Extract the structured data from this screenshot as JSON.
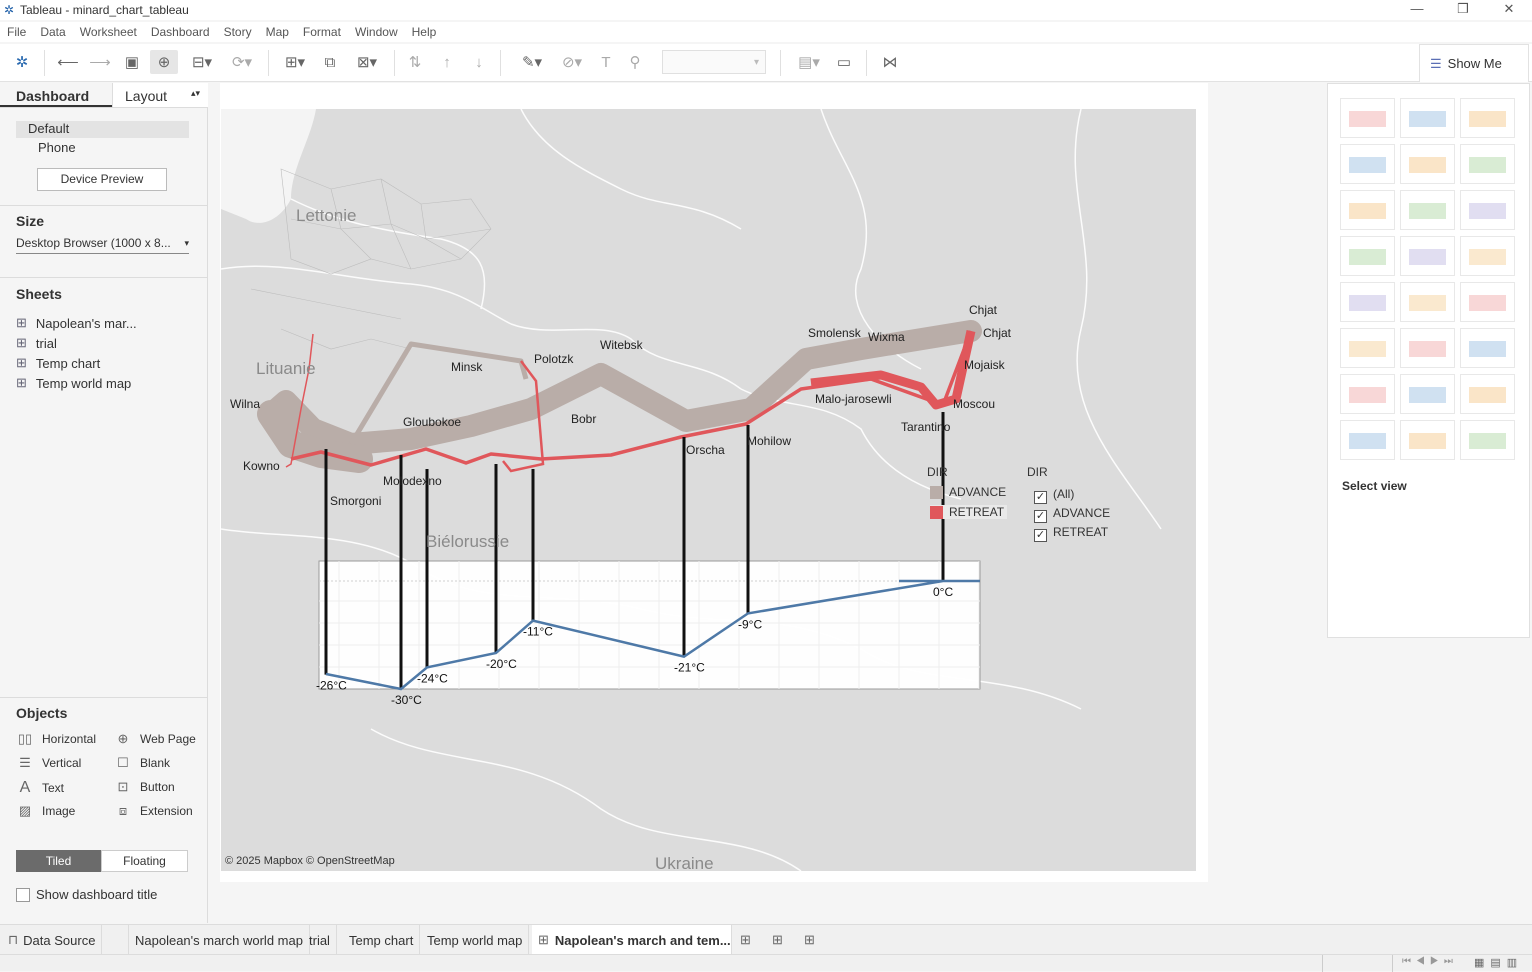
{
  "window": {
    "title": "Tableau - minard_chart_tableau",
    "controls": [
      "—",
      "❒",
      "✕"
    ]
  },
  "menu": [
    "File",
    "Data",
    "Worksheet",
    "Dashboard",
    "Story",
    "Map",
    "Format",
    "Window",
    "Help"
  ],
  "show_me": {
    "label": "Show Me",
    "select_view": "Select view"
  },
  "left": {
    "tab_dashboard": "Dashboard",
    "tab_layout": "Layout",
    "devices": [
      "Default",
      "Phone"
    ],
    "device_preview": "Device Preview",
    "size_title": "Size",
    "size_value": "Desktop Browser (1000 x 8...",
    "sheets_title": "Sheets",
    "sheets": [
      "Napolean's mar...",
      "trial",
      "Temp chart",
      "Temp world map"
    ],
    "objects_title": "Objects",
    "objects": [
      "Horizontal",
      "Web Page",
      "Vertical",
      "Blank",
      "Text",
      "Button",
      "Image",
      "Extension"
    ],
    "tiled": "Tiled",
    "floating": "Floating",
    "show_title": "Show dashboard title"
  },
  "map": {
    "cities": [
      "Chjat",
      "Chjat",
      "Smolensk",
      "Wixma",
      "Mojaisk",
      "Polotzk",
      "Witebsk",
      "Minsk",
      "Malo-jarosewli",
      "Moscou",
      "Tarantino",
      "Gloubokoe",
      "Bobr",
      "Wilna",
      "Mohilow",
      "Orscha",
      "Kowno",
      "Molodexno",
      "Smorgoni"
    ],
    "regions": [
      "Lettonie",
      "Lituanie",
      "Biélorussie",
      "Ukraine"
    ],
    "attribution": "© 2025 Mapbox © OpenStreetMap",
    "temps": [
      "-26°C",
      "-30°C",
      "-24°C",
      "-20°C",
      "-11°C",
      "-21°C",
      "-9°C",
      "0°C"
    ]
  },
  "legend": {
    "title": "DIR",
    "items": [
      "ADVANCE",
      "RETREAT"
    ],
    "colors": {
      "advance": "#b9ada8",
      "retreat": "#e0575b"
    }
  },
  "filter": {
    "title": "DIR",
    "items": [
      "(All)",
      "ADVANCE",
      "RETREAT"
    ]
  },
  "tabs": [
    "Data Source",
    "Napolean's march world map",
    "trial",
    "Temp chart",
    "Temp world map",
    "Napolean's march and tem..."
  ],
  "colors": {
    "advance": "#b9ada8",
    "retreat": "#e0575b",
    "temp_line": "#4e79a7",
    "map_bg": "#dcdcdc",
    "selected_tab": "#ffffff"
  }
}
